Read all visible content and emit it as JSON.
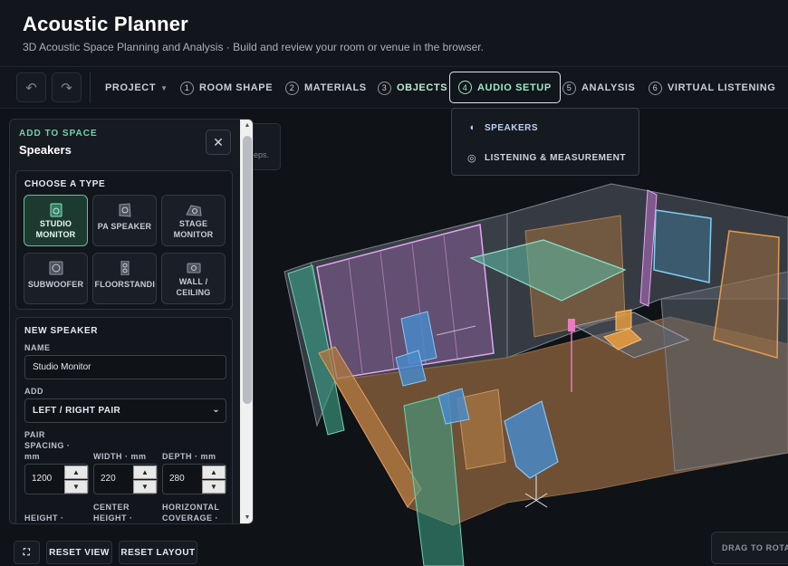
{
  "app": {
    "title": "Acoustic Planner",
    "subtitle": "3D Acoustic Space Planning and Analysis · Build and review your room or venue in the browser."
  },
  "toolbar": {
    "undo_icon": "undo-icon",
    "redo_icon": "redo-icon",
    "project_label": "PROJECT",
    "steps": [
      {
        "num": "1",
        "label": "ROOM SHAPE"
      },
      {
        "num": "2",
        "label": "MATERIALS"
      },
      {
        "num": "3",
        "label": "OBJECTS"
      },
      {
        "num": "4",
        "label": "AUDIO SETUP"
      },
      {
        "num": "5",
        "label": "ANALYSIS"
      },
      {
        "num": "6",
        "label": "VIRTUAL LISTENING"
      }
    ],
    "active_step": "4"
  },
  "audio_menu": {
    "items": [
      {
        "icon": "speaker-icon",
        "label": "SPEAKERS"
      },
      {
        "icon": "target-icon",
        "label": "LISTENING & MEASUREMENT"
      }
    ],
    "selected": "SPEAKERS"
  },
  "viewport_hint": {
    "text": "eps."
  },
  "panel": {
    "eyebrow": "ADD TO SPACE",
    "title": "Speakers",
    "choose_type": {
      "title": "CHOOSE A TYPE",
      "types": [
        {
          "label_1": "STUDIO",
          "label_2": "MONITOR",
          "icon": "studio-monitor-icon"
        },
        {
          "label_1": "PA SPEAKER",
          "label_2": "",
          "icon": "pa-speaker-icon"
        },
        {
          "label_1": "STAGE",
          "label_2": "MONITOR",
          "icon": "stage-monitor-icon"
        },
        {
          "label_1": "SUBWOOFER",
          "label_2": "",
          "icon": "subwoofer-icon"
        },
        {
          "label_1": "FLOORSTANDII",
          "label_2": "",
          "icon": "floorstanding-icon"
        },
        {
          "label_1": "WALL /",
          "label_2": "CEILING",
          "icon": "wall-ceiling-icon"
        }
      ],
      "selected": "STUDIO MONITOR"
    },
    "new_speaker": {
      "title": "NEW SPEAKER",
      "name_label": "NAME",
      "name_value": "Studio Monitor",
      "add_label": "ADD",
      "add_value": "LEFT / RIGHT PAIR",
      "pair_spacing_label_1": "PAIR",
      "pair_spacing_label_2": "SPACING ·",
      "pair_spacing_label_3": "mm",
      "pair_spacing_value": "1200",
      "width_label": "WIDTH · mm",
      "width_value": "220",
      "depth_label": "DEPTH · mm",
      "depth_value": "280",
      "height_label": "HEIGHT ·",
      "center_height_label_1": "CENTER",
      "center_height_label_2": "HEIGHT ·",
      "horizontal_coverage_label_1": "HORIZONTAL",
      "horizontal_coverage_label_2": "COVERAGE ·"
    }
  },
  "bottom": {
    "fullscreen_icon": "fullscreen-icon",
    "reset_view": "RESET VIEW",
    "reset_layout": "RESET LAYOUT",
    "drag_hint": "DRAG TO ROTATE"
  },
  "colors": {
    "accent_green": "#6fd3a8",
    "accent_blue": "#bcd3f5",
    "background": "#0e1116"
  }
}
